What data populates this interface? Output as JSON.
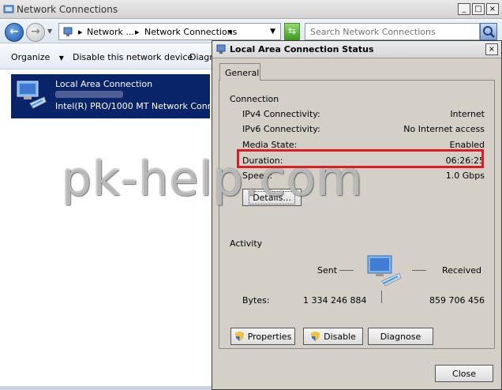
{
  "main_window": {
    "title": "Network Connections",
    "win_min": "_",
    "win_max": "□",
    "win_close": "×"
  },
  "address_bar": {
    "crumbs": [
      "Network ...",
      "Network Connections"
    ],
    "search_placeholder": "Search Network Connections"
  },
  "command_bar": {
    "organize": "Organize",
    "disable": "Disable this network device",
    "diagnose_partial": "Diagn"
  },
  "connection": {
    "name": "Local Area Connection",
    "adapter": "Intel(R) PRO/1000 MT Network Conn..."
  },
  "dialog": {
    "title": "Local Area Connection Status",
    "close_glyph": "×",
    "tab": "General",
    "connection_section": "Connection",
    "rows": [
      {
        "label": "IPv4 Connectivity:",
        "value": "Internet"
      },
      {
        "label": "IPv6 Connectivity:",
        "value": "No Internet access"
      },
      {
        "label": "Media State:",
        "value": "Enabled"
      },
      {
        "label": "Duration:",
        "value": "06:26:25"
      },
      {
        "label": "Speed:",
        "value": "1.0 Gbps"
      }
    ],
    "details_button": "Details...",
    "activity_section": "Activity",
    "sent_label": "Sent",
    "received_label": "Received",
    "bytes_label": "Bytes:",
    "bytes_sent": "1 334 246 884",
    "bytes_received": "859 706 456",
    "properties_button": "Properties",
    "disable_button": "Disable",
    "diagnose_button": "Diagnose",
    "close_button": "Close"
  },
  "watermark": "pk-help.com",
  "colors": {
    "selection": "#0a246a",
    "dialog_face": "#d4d0c8",
    "highlight_box": "#e01b24"
  }
}
